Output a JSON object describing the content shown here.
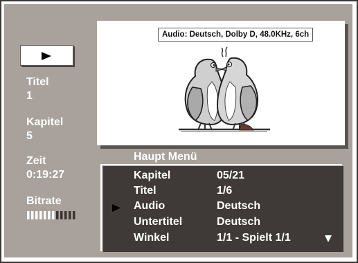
{
  "sidebar": {
    "play_symbol": "play-icon",
    "title_label": "Titel",
    "title_value": "1",
    "chapter_label": "Kapitel",
    "chapter_value": "5",
    "time_label": "Zeit",
    "time_value": "0:19:27",
    "bitrate_label": "Bitrate",
    "bitrate_level": 0.6
  },
  "video": {
    "audio_info": "Audio: Deutsch, Dolby D, 48.0KHz, 6ch"
  },
  "menu": {
    "title": "Haupt Menü",
    "selected_index": 2,
    "rows": [
      {
        "label": "Kapitel",
        "value": "05/21"
      },
      {
        "label": "Titel",
        "value": "1/6"
      },
      {
        "label": "Audio",
        "value": "Deutsch"
      },
      {
        "label": "Untertitel",
        "value": "Deutsch"
      },
      {
        "label": "Winkel",
        "value": "1/1 - Spielt 1/1"
      }
    ],
    "more_indicator": "scroll-down-icon"
  },
  "colors": {
    "screen_bg": "#a8a19c",
    "text": "#ffffff",
    "panel_shadow": "#3f3a37"
  }
}
